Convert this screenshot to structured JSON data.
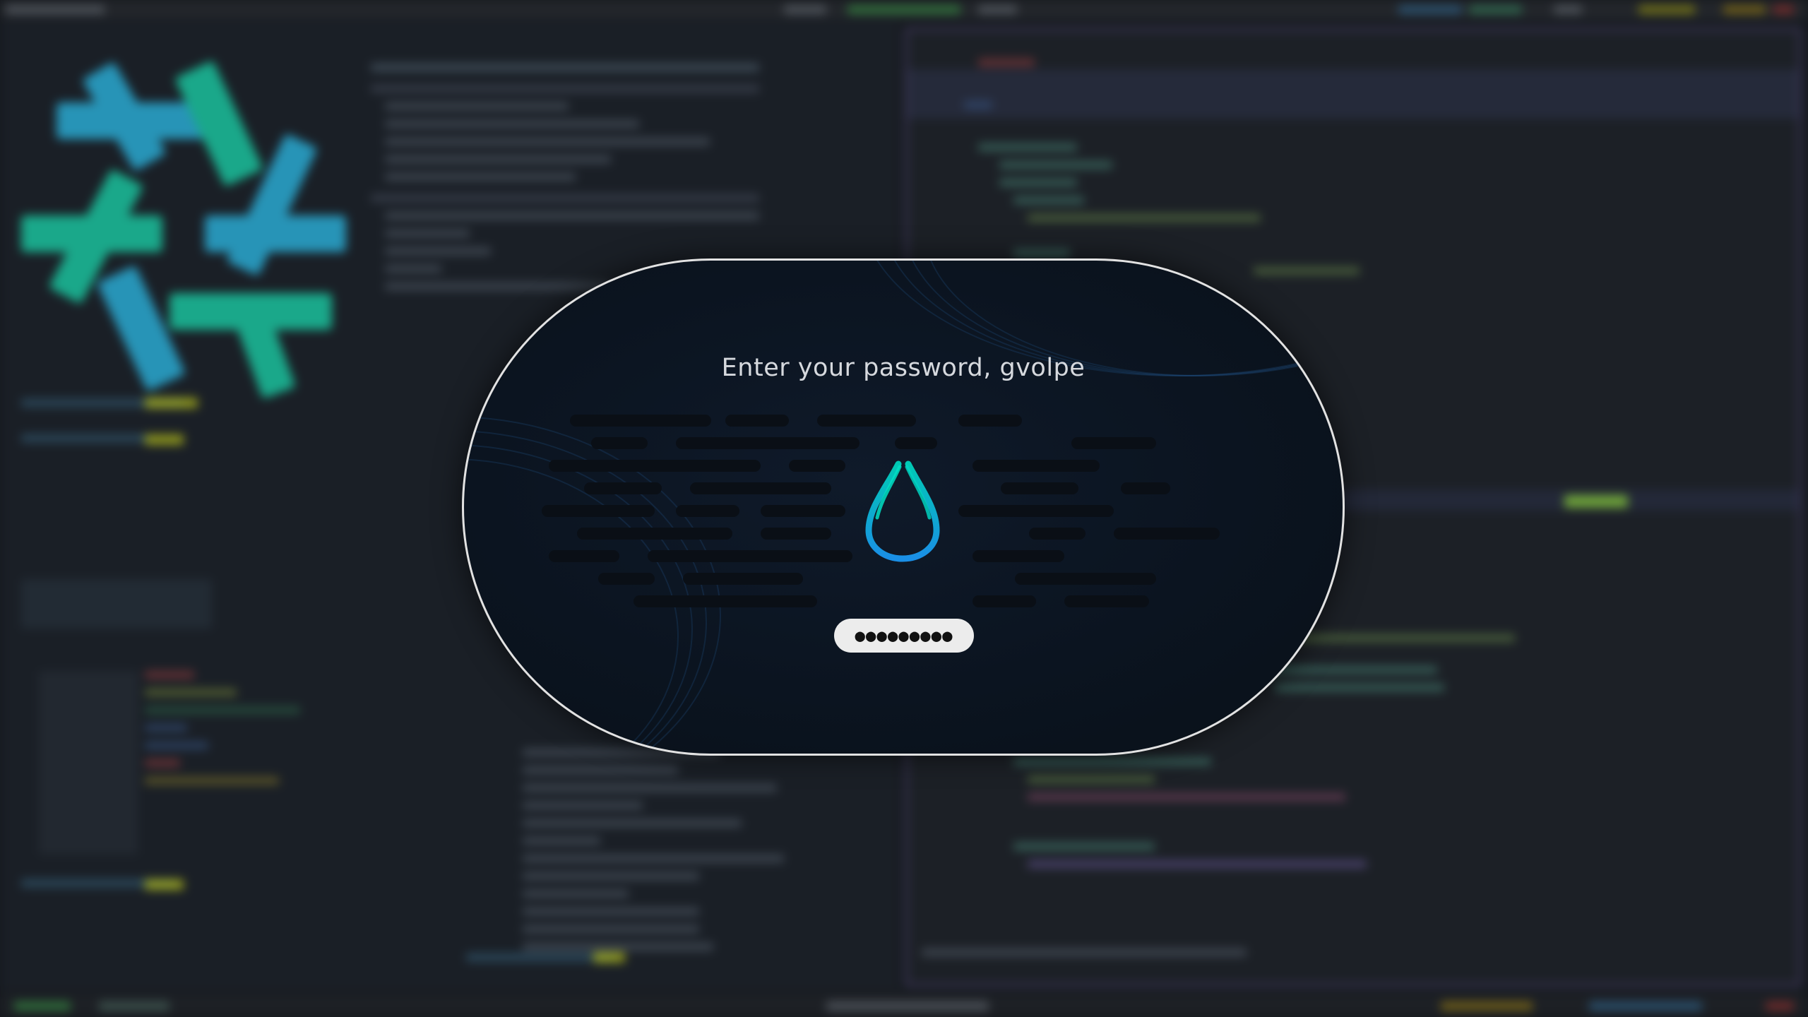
{
  "lock_screen": {
    "prompt": "Enter your password, gvolpe",
    "password_mask": "●●●●●●●●●",
    "icon": "water-drop-icon",
    "colors": {
      "border": "#e2e2e2",
      "icon_gradient_start": "#00c9b4",
      "icon_gradient_end": "#1a8fe6",
      "field_background": "#ececec"
    }
  },
  "background": {
    "state": "blurred",
    "logo": "nixos-snowflake-icon",
    "colors": {
      "logo_teal": "#1aa88a",
      "logo_blue": "#2794b7",
      "editor_border": "#4b3f6e",
      "accent_yellow": "#b9c21b",
      "accent_green": "#7fbf3a"
    }
  }
}
